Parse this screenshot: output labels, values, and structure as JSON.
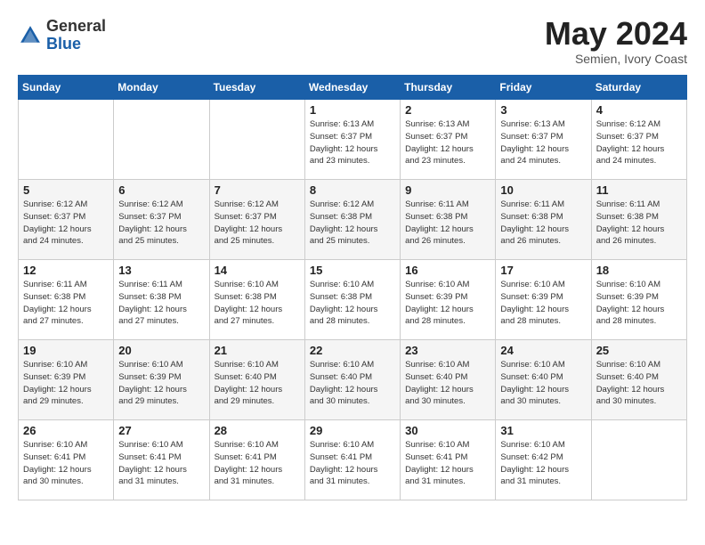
{
  "header": {
    "logo_general": "General",
    "logo_blue": "Blue",
    "month_title": "May 2024",
    "location": "Semien, Ivory Coast"
  },
  "weekdays": [
    "Sunday",
    "Monday",
    "Tuesday",
    "Wednesday",
    "Thursday",
    "Friday",
    "Saturday"
  ],
  "weeks": [
    [
      {
        "day": "",
        "info": ""
      },
      {
        "day": "",
        "info": ""
      },
      {
        "day": "",
        "info": ""
      },
      {
        "day": "1",
        "info": "Sunrise: 6:13 AM\nSunset: 6:37 PM\nDaylight: 12 hours\nand 23 minutes."
      },
      {
        "day": "2",
        "info": "Sunrise: 6:13 AM\nSunset: 6:37 PM\nDaylight: 12 hours\nand 23 minutes."
      },
      {
        "day": "3",
        "info": "Sunrise: 6:13 AM\nSunset: 6:37 PM\nDaylight: 12 hours\nand 24 minutes."
      },
      {
        "day": "4",
        "info": "Sunrise: 6:12 AM\nSunset: 6:37 PM\nDaylight: 12 hours\nand 24 minutes."
      }
    ],
    [
      {
        "day": "5",
        "info": "Sunrise: 6:12 AM\nSunset: 6:37 PM\nDaylight: 12 hours\nand 24 minutes."
      },
      {
        "day": "6",
        "info": "Sunrise: 6:12 AM\nSunset: 6:37 PM\nDaylight: 12 hours\nand 25 minutes."
      },
      {
        "day": "7",
        "info": "Sunrise: 6:12 AM\nSunset: 6:37 PM\nDaylight: 12 hours\nand 25 minutes."
      },
      {
        "day": "8",
        "info": "Sunrise: 6:12 AM\nSunset: 6:38 PM\nDaylight: 12 hours\nand 25 minutes."
      },
      {
        "day": "9",
        "info": "Sunrise: 6:11 AM\nSunset: 6:38 PM\nDaylight: 12 hours\nand 26 minutes."
      },
      {
        "day": "10",
        "info": "Sunrise: 6:11 AM\nSunset: 6:38 PM\nDaylight: 12 hours\nand 26 minutes."
      },
      {
        "day": "11",
        "info": "Sunrise: 6:11 AM\nSunset: 6:38 PM\nDaylight: 12 hours\nand 26 minutes."
      }
    ],
    [
      {
        "day": "12",
        "info": "Sunrise: 6:11 AM\nSunset: 6:38 PM\nDaylight: 12 hours\nand 27 minutes."
      },
      {
        "day": "13",
        "info": "Sunrise: 6:11 AM\nSunset: 6:38 PM\nDaylight: 12 hours\nand 27 minutes."
      },
      {
        "day": "14",
        "info": "Sunrise: 6:10 AM\nSunset: 6:38 PM\nDaylight: 12 hours\nand 27 minutes."
      },
      {
        "day": "15",
        "info": "Sunrise: 6:10 AM\nSunset: 6:38 PM\nDaylight: 12 hours\nand 28 minutes."
      },
      {
        "day": "16",
        "info": "Sunrise: 6:10 AM\nSunset: 6:39 PM\nDaylight: 12 hours\nand 28 minutes."
      },
      {
        "day": "17",
        "info": "Sunrise: 6:10 AM\nSunset: 6:39 PM\nDaylight: 12 hours\nand 28 minutes."
      },
      {
        "day": "18",
        "info": "Sunrise: 6:10 AM\nSunset: 6:39 PM\nDaylight: 12 hours\nand 28 minutes."
      }
    ],
    [
      {
        "day": "19",
        "info": "Sunrise: 6:10 AM\nSunset: 6:39 PM\nDaylight: 12 hours\nand 29 minutes."
      },
      {
        "day": "20",
        "info": "Sunrise: 6:10 AM\nSunset: 6:39 PM\nDaylight: 12 hours\nand 29 minutes."
      },
      {
        "day": "21",
        "info": "Sunrise: 6:10 AM\nSunset: 6:40 PM\nDaylight: 12 hours\nand 29 minutes."
      },
      {
        "day": "22",
        "info": "Sunrise: 6:10 AM\nSunset: 6:40 PM\nDaylight: 12 hours\nand 30 minutes."
      },
      {
        "day": "23",
        "info": "Sunrise: 6:10 AM\nSunset: 6:40 PM\nDaylight: 12 hours\nand 30 minutes."
      },
      {
        "day": "24",
        "info": "Sunrise: 6:10 AM\nSunset: 6:40 PM\nDaylight: 12 hours\nand 30 minutes."
      },
      {
        "day": "25",
        "info": "Sunrise: 6:10 AM\nSunset: 6:40 PM\nDaylight: 12 hours\nand 30 minutes."
      }
    ],
    [
      {
        "day": "26",
        "info": "Sunrise: 6:10 AM\nSunset: 6:41 PM\nDaylight: 12 hours\nand 30 minutes."
      },
      {
        "day": "27",
        "info": "Sunrise: 6:10 AM\nSunset: 6:41 PM\nDaylight: 12 hours\nand 31 minutes."
      },
      {
        "day": "28",
        "info": "Sunrise: 6:10 AM\nSunset: 6:41 PM\nDaylight: 12 hours\nand 31 minutes."
      },
      {
        "day": "29",
        "info": "Sunrise: 6:10 AM\nSunset: 6:41 PM\nDaylight: 12 hours\nand 31 minutes."
      },
      {
        "day": "30",
        "info": "Sunrise: 6:10 AM\nSunset: 6:41 PM\nDaylight: 12 hours\nand 31 minutes."
      },
      {
        "day": "31",
        "info": "Sunrise: 6:10 AM\nSunset: 6:42 PM\nDaylight: 12 hours\nand 31 minutes."
      },
      {
        "day": "",
        "info": ""
      }
    ]
  ]
}
